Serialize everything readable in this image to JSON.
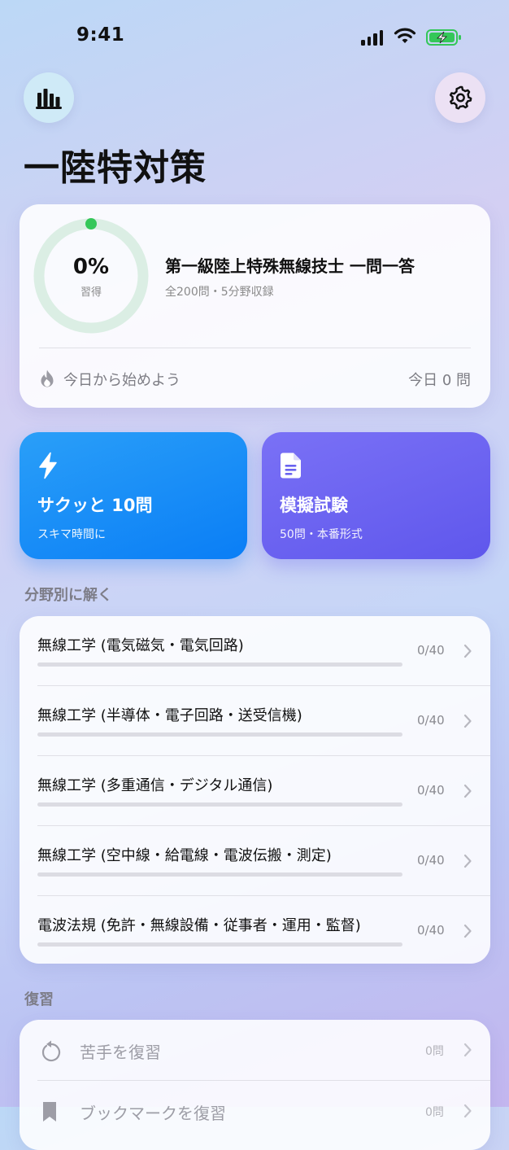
{
  "status_bar": {
    "time": "9:41"
  },
  "header": {
    "title": "一陸特対策"
  },
  "progress": {
    "percent_text": "0%",
    "percent_label": "習得",
    "mastery": 0,
    "exam_name": "第一級陸上特殊無線技士 一問一答",
    "exam_info": "全200問・5分野収録",
    "streak_text": "今日から始めよう",
    "today_text": "今日 0 問",
    "ring_color": "#34c759"
  },
  "actions": {
    "quick": {
      "title": "サクッと 10問",
      "subtitle": "スキマ時間に",
      "icon": "bolt-icon",
      "color": "#0a84ff"
    },
    "mock": {
      "title": "模擬試験",
      "subtitle": "50問・本番形式",
      "icon": "document-icon",
      "color": "#5e5ce6"
    }
  },
  "fields": {
    "heading": "分野別に解く",
    "items": [
      {
        "name": "無線工学 (電気磁気・電気回路)",
        "count": "0/40",
        "progress": 0
      },
      {
        "name": "無線工学 (半導体・電子回路・送受信機)",
        "count": "0/40",
        "progress": 0
      },
      {
        "name": "無線工学 (多重通信・デジタル通信)",
        "count": "0/40",
        "progress": 0
      },
      {
        "name": "無線工学 (空中線・給電線・電波伝搬・測定)",
        "count": "0/40",
        "progress": 0
      },
      {
        "name": "電波法規 (免許・無線設備・従事者・運用・監督)",
        "count": "0/40",
        "progress": 0
      }
    ]
  },
  "review": {
    "heading": "復習",
    "items": [
      {
        "name": "苦手を復習",
        "count": "0問",
        "icon": "retry-icon"
      },
      {
        "name": "ブックマークを復習",
        "count": "0問",
        "icon": "bookmark-icon"
      }
    ]
  }
}
